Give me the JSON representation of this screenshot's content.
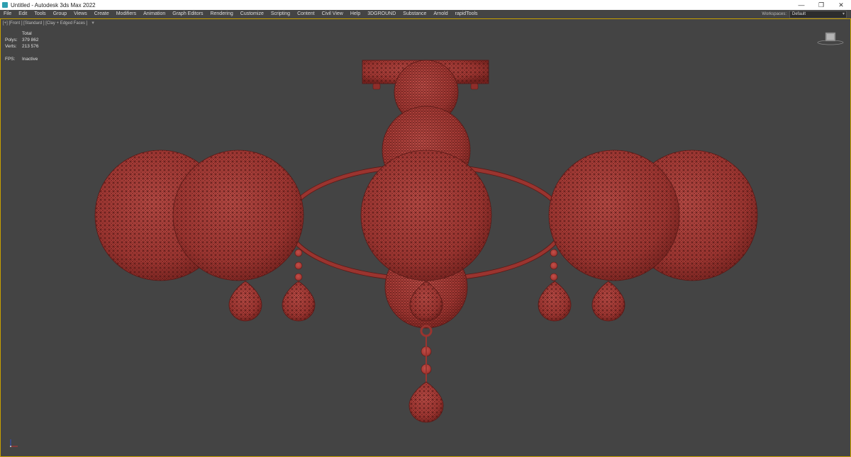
{
  "window": {
    "title": "Untitled - Autodesk 3ds Max 2022",
    "minimize_icon": "minimize-icon",
    "restore_icon": "restore-icon",
    "close_icon": "close-icon"
  },
  "menu": {
    "items": [
      "File",
      "Edit",
      "Tools",
      "Group",
      "Views",
      "Create",
      "Modifiers",
      "Animation",
      "Graph Editors",
      "Rendering",
      "Customize",
      "Scripting",
      "Content",
      "Civil View",
      "Help",
      "3DGROUND",
      "Substance",
      "Arnold",
      "rapidTools"
    ],
    "workspaces_label": "Workspaces:",
    "workspace_value": "Default"
  },
  "viewport": {
    "label": "[+] [Front ] [Standard ] [Clay + Edged Faces ]",
    "filter_icon": "filter-icon",
    "stats": {
      "header": "Total",
      "polys_label": "Polys:",
      "polys_value": "379 862",
      "verts_label": "Verts:",
      "verts_value": "213 576",
      "fps_label": "FPS:",
      "fps_value": "Inactive"
    },
    "model_color": "#a83a35",
    "background_color": "#444444",
    "highlight_border": "#c8a000"
  }
}
